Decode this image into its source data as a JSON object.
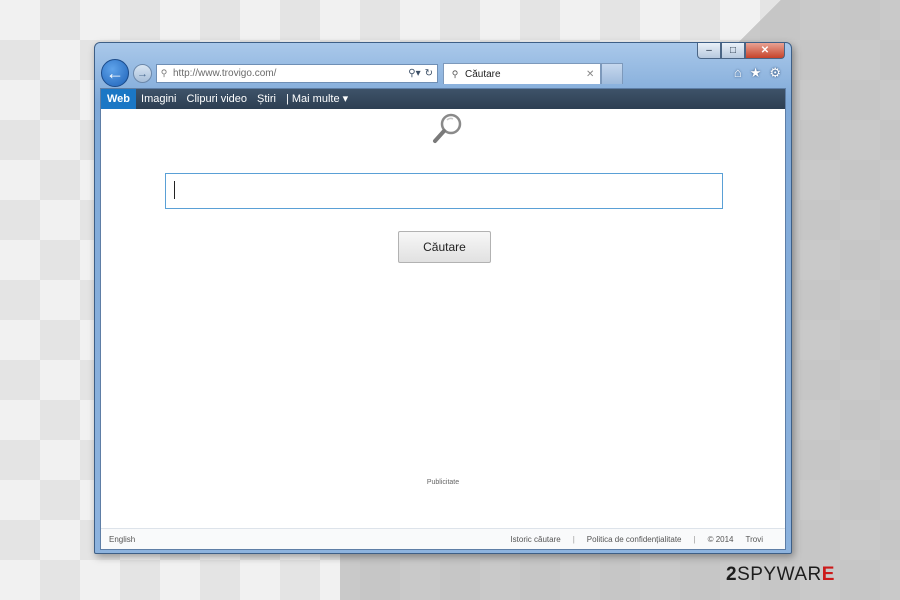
{
  "browser": {
    "address_url": "http://www.trovigo.com/",
    "tab_label": "Căutare",
    "window_minimize": "–",
    "window_maximize": "□",
    "window_close": "✕"
  },
  "menubar": {
    "items": [
      {
        "label": "Web",
        "active": true
      },
      {
        "label": "Imagini"
      },
      {
        "label": "Clipuri video"
      },
      {
        "label": "Știri"
      },
      {
        "label": "| Mai multe ▾"
      }
    ]
  },
  "search": {
    "input_value": "",
    "button_label": "Căutare"
  },
  "ads_label": "Publicitate",
  "footer": {
    "language": "English",
    "links": [
      "Istoric căutare",
      "Politica de confidențialitate",
      "© 2014",
      "Trovi"
    ]
  },
  "watermark": {
    "prefix": "2",
    "main": "SPYWAR",
    "suffix": "E"
  },
  "colors": {
    "menubar_bg": "#2d3f52",
    "menubar_active": "#1b77c5",
    "input_border": "#5aa0d6",
    "window_frame": "#7fa9d8"
  },
  "icons": [
    "back-arrow-icon",
    "forward-arrow-icon",
    "search-icon",
    "refresh-icon",
    "home-icon",
    "star-icon",
    "gear-icon",
    "magnifier-icon"
  ]
}
